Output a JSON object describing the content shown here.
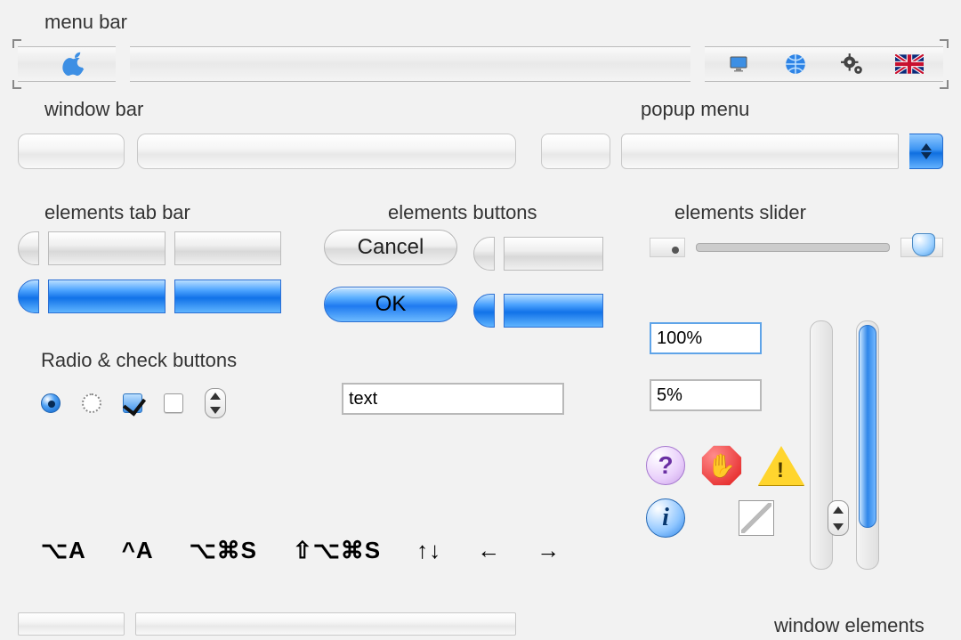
{
  "labels": {
    "menu_bar": "menu bar",
    "window_bar": "window bar",
    "popup_menu": "popup menu",
    "elements_tab_bar": "elements tab bar",
    "elements_buttons": "elements buttons",
    "elements_slider": "elements slider",
    "radio_check": "Radio & check buttons",
    "window_elements": "window elements"
  },
  "buttons": {
    "cancel": "Cancel",
    "ok": "OK"
  },
  "text_field": {
    "value": "text"
  },
  "percent_fields": {
    "top": "100%",
    "bottom": "5%"
  },
  "menubar_icons": [
    "monitor-icon",
    "globe-icon",
    "gear-icon",
    "flag-uk-icon"
  ],
  "shortcuts": [
    "⌥A",
    "^A",
    "⌥⌘S",
    "⇧⌥⌘S",
    "↑↓",
    "←",
    "→"
  ],
  "alert_icons": [
    "help-icon",
    "stop-icon",
    "warning-icon",
    "info-icon",
    "image-well"
  ],
  "colors": {
    "aqua_blue": "#2f86e9",
    "aqua_blue_dark": "#0e63c8",
    "panel_bg": "#f2f2f2"
  }
}
